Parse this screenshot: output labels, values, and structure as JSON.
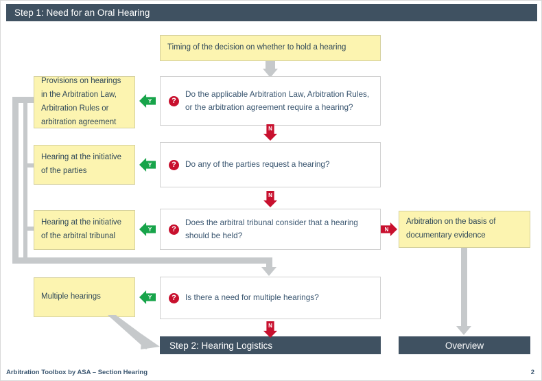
{
  "slide": {
    "title": "Step 1: Need for an Oral Hearing",
    "footer_text": "Arbitration Toolbox by ASA – Section Hearing",
    "page_number": "2"
  },
  "colors": {
    "header_bar": "#3f5161",
    "yellow_box": "#fcf4b0",
    "yellow_border": "#d4cf9b",
    "question_box": "#ffffff",
    "question_border": "#cfcfcf",
    "text_blue": "#3a5670",
    "yes_green": "#17a44a",
    "no_red": "#c8102e",
    "connector_gray": "#c6c9cb"
  },
  "entry": {
    "label": "Timing of the decision on whether to hold a hearing"
  },
  "outcomes": [
    {
      "label": "Provisions on hearings in the Arbitration Law, Arbitration Rules or arbitration agreement"
    },
    {
      "label": "Hearing at the initiative of the parties"
    },
    {
      "label": "Hearing at the initiative of the arbitral tribunal"
    },
    {
      "label": "Multiple hearings"
    }
  ],
  "questions": [
    {
      "text": "Do the applicable Arbitration Law, Arbitration Rules, or the arbitration agreement require a hearing?",
      "icon": "question-mark-icon"
    },
    {
      "text": "Do any of the parties request a hearing?",
      "icon": "question-mark-icon"
    },
    {
      "text": "Does the arbitral tribunal consider that a hearing should be held?",
      "icon": "question-mark-icon"
    },
    {
      "text": "Is there a need for multiple hearings?",
      "icon": "question-mark-icon"
    }
  ],
  "markers": {
    "yes": "Y",
    "no": "N"
  },
  "right_branch": {
    "label": "Arbitration on the basis of documentary evidence"
  },
  "targets": {
    "step2": "Step 2: Hearing Logistics",
    "overview": "Overview"
  }
}
